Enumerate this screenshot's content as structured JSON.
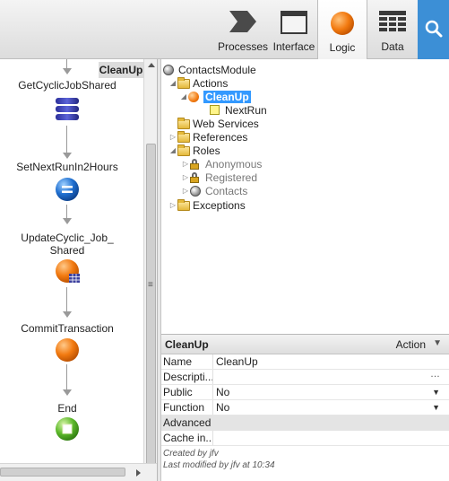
{
  "toolbar": {
    "tabs": [
      {
        "label": "Processes",
        "icon": "processes-chevron-icon",
        "active": false
      },
      {
        "label": "Interface",
        "icon": "interface-window-icon",
        "active": false
      },
      {
        "label": "Logic",
        "icon": "logic-orange-circle-icon",
        "active": true
      },
      {
        "label": "Data",
        "icon": "data-grid-icon",
        "active": false
      }
    ],
    "search_icon": "search-icon"
  },
  "canvas": {
    "title": "CleanUp",
    "nodes": [
      {
        "label": "GetCyclicJobShared",
        "icon": "database-stack-icon"
      },
      {
        "label": "SetNextRunIn2Hours",
        "icon": "assign-icon"
      },
      {
        "label": "UpdateCyclic_Job_\nShared",
        "icon": "entity-action-icon"
      },
      {
        "label": "CommitTransaction",
        "icon": "action-circle-icon"
      },
      {
        "label": "End",
        "icon": "end-icon"
      }
    ]
  },
  "tree": {
    "module": "ContactsModule",
    "actions": "Actions",
    "selected_action": "CleanUp",
    "variable": "NextRun",
    "web_services": "Web Services",
    "references": "References",
    "roles": "Roles",
    "role_items": [
      "Anonymous",
      "Registered",
      "Contacts"
    ],
    "exceptions": "Exceptions"
  },
  "properties": {
    "title": "CleanUp",
    "kind": "Action",
    "rows": [
      {
        "name": "Name",
        "value": "CleanUp"
      },
      {
        "name": "Descripti...",
        "value": ""
      },
      {
        "name": "Public",
        "value": "No"
      },
      {
        "name": "Function",
        "value": "No"
      }
    ],
    "section": "Advanced",
    "cache_row": {
      "name": "Cache in...",
      "value": ""
    },
    "created_by": "Created by jfv",
    "modified_by": "Last modified by jfv at 10:34"
  },
  "colors": {
    "accent": "#3c8fd6",
    "selection": "#3399ff",
    "logic_orange": "#f27a10",
    "end_green": "#5cb82a"
  }
}
